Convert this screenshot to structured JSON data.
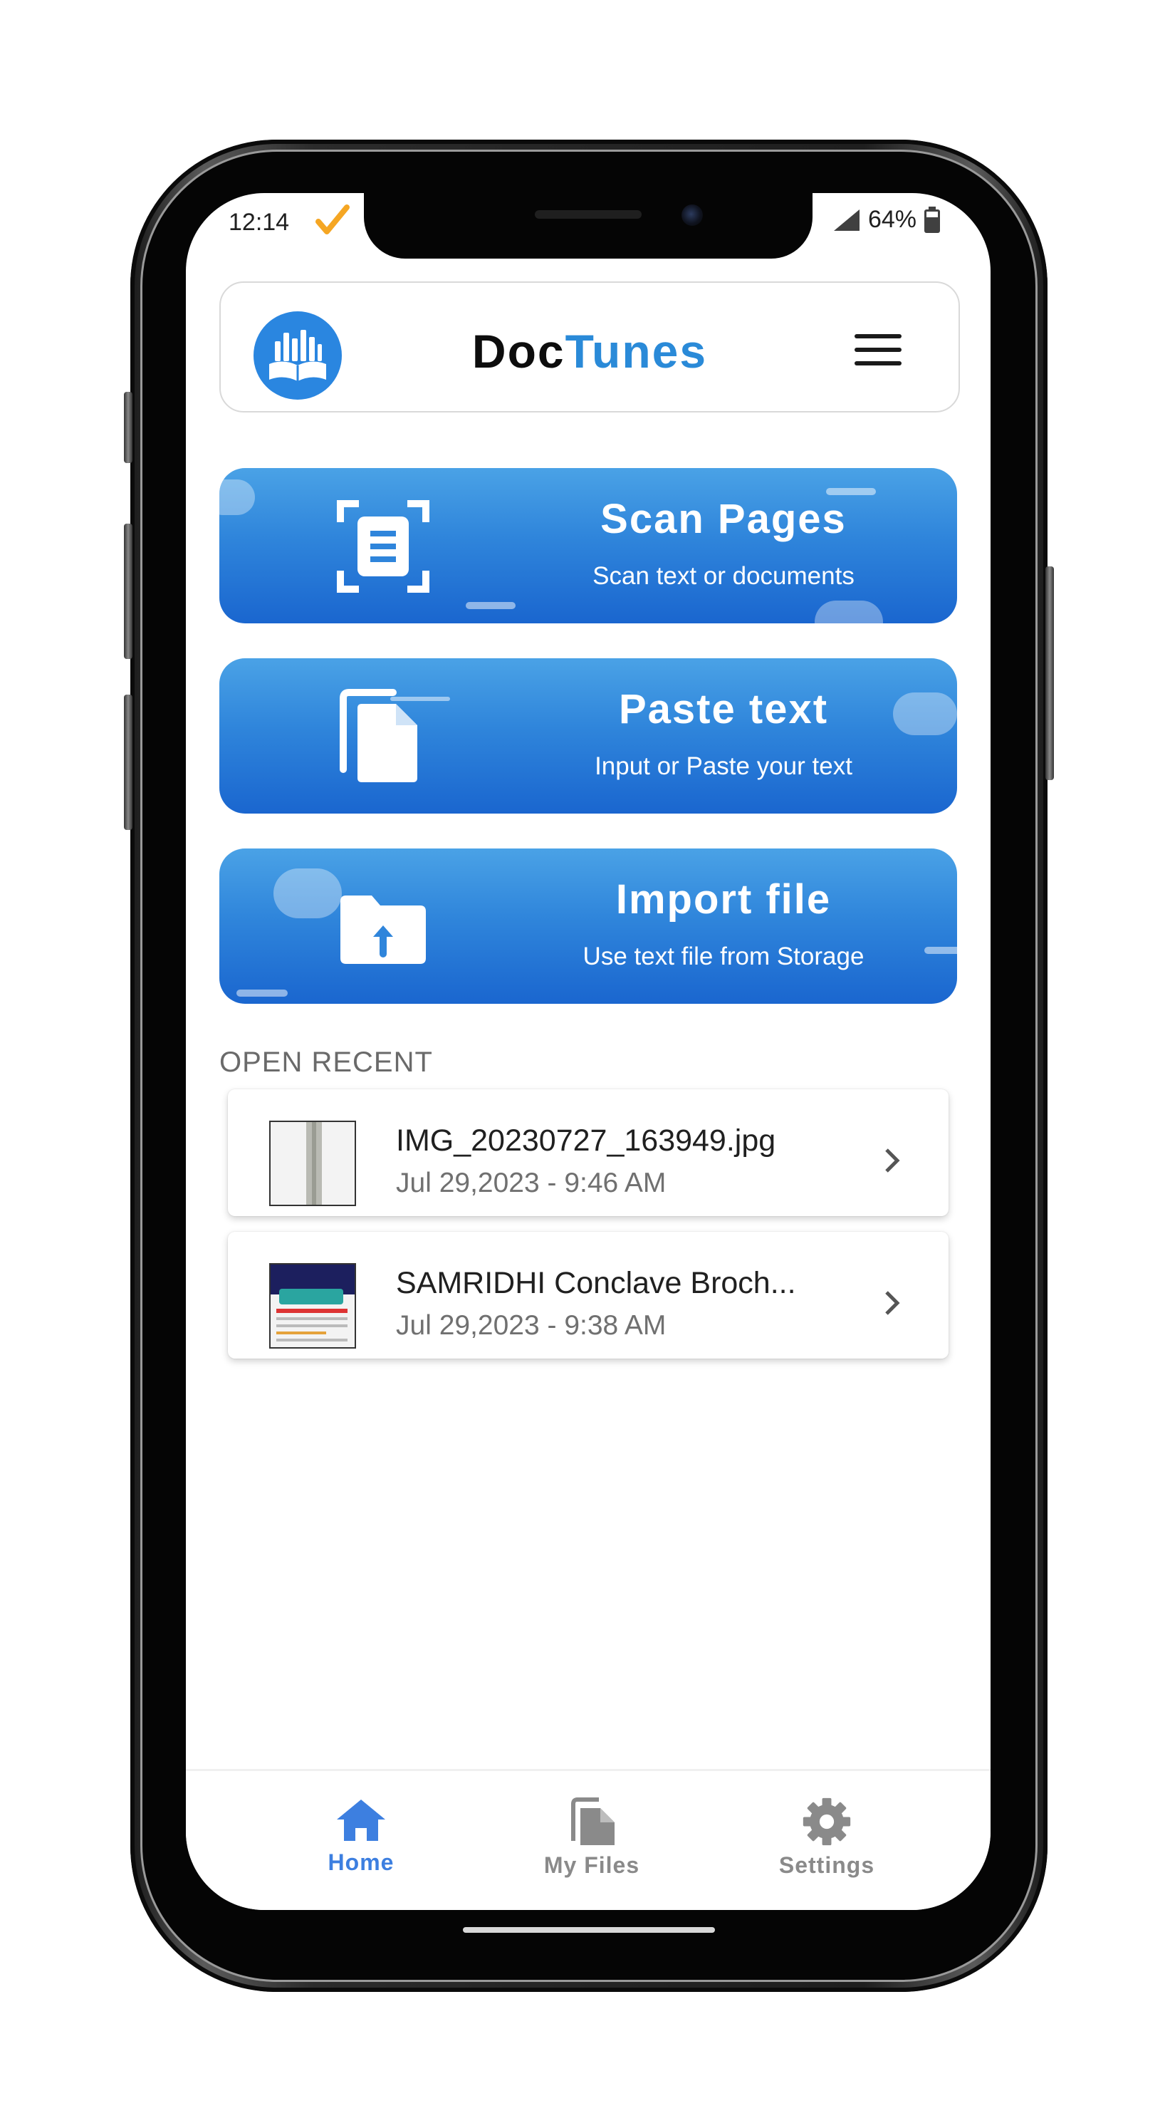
{
  "status_bar": {
    "time": "12:14",
    "battery": "64%"
  },
  "header": {
    "title_part1": "Doc",
    "title_part2": "Tunes"
  },
  "actions": [
    {
      "label": "Scan Pages",
      "subtitle": "Scan text or documents",
      "icon": "scan-document-icon"
    },
    {
      "label": "Paste text",
      "subtitle": "Input or Paste your text",
      "icon": "paste-copy-icon"
    },
    {
      "label": "Import file",
      "subtitle": "Use text file from Storage",
      "icon": "folder-upload-icon"
    }
  ],
  "recent": {
    "title": "OPEN RECENT",
    "items": [
      {
        "name": "IMG_20230727_163949.jpg",
        "date": "Jul 29,2023 - 9:46 AM"
      },
      {
        "name": "SAMRIDHI Conclave Broch...",
        "date": "Jul 29,2023 - 9:38 AM"
      }
    ]
  },
  "nav": {
    "home": "Home",
    "my_files": "My Files",
    "settings": "Settings",
    "active_color": "#3d7fe0",
    "inactive_color": "#8a8a8a"
  }
}
